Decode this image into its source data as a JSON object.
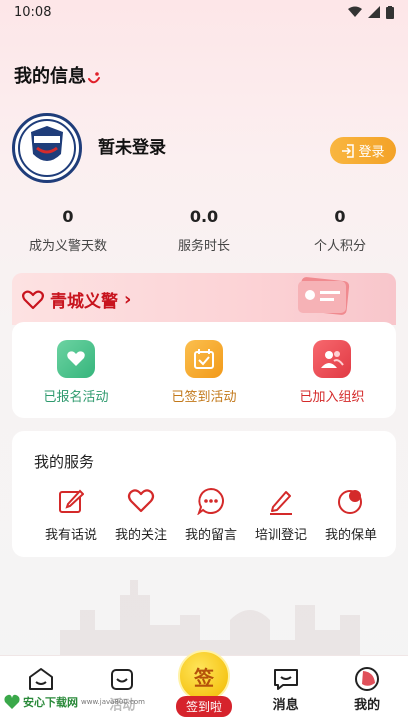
{
  "status_bar": {
    "time": "10:08"
  },
  "page": {
    "title": "我的信息"
  },
  "profile": {
    "avatar_text": "青城义警",
    "name": "暂未登录",
    "login_label": "登录"
  },
  "stats": [
    {
      "value": "0",
      "label": "成为义警天数"
    },
    {
      "value": "0.0",
      "label": "服务时长"
    },
    {
      "value": "0",
      "label": "个人积分"
    }
  ],
  "banner": {
    "title": "青城义警",
    "arrow": "›"
  },
  "activities": [
    {
      "label": "已报名活动",
      "color": "#2e9a6e",
      "icon": "heart-chat-icon"
    },
    {
      "label": "已签到活动",
      "color": "#c2781a",
      "icon": "calendar-check-icon"
    },
    {
      "label": "已加入组织",
      "color": "#d42a2a",
      "icon": "group-icon"
    }
  ],
  "services": {
    "title": "我的服务",
    "items": [
      {
        "label": "我有话说",
        "icon": "edit-icon"
      },
      {
        "label": "我的关注",
        "icon": "heart-icon"
      },
      {
        "label": "我的留言",
        "icon": "comment-icon"
      },
      {
        "label": "培训登记",
        "icon": "pen-icon"
      },
      {
        "label": "我的保单",
        "icon": "policy-icon"
      }
    ]
  },
  "tabbar": {
    "items": [
      {
        "label": ""
      },
      {
        "label": "活动"
      },
      {
        "label": "签到啦",
        "sign_char": "签"
      },
      {
        "label": "消息"
      },
      {
        "label": "我的"
      }
    ]
  },
  "watermark": {
    "name": "安心下载网",
    "url": "www.java800.com"
  },
  "colors": {
    "brand_red": "#c8141e",
    "accent_orange": "#f3a227"
  }
}
